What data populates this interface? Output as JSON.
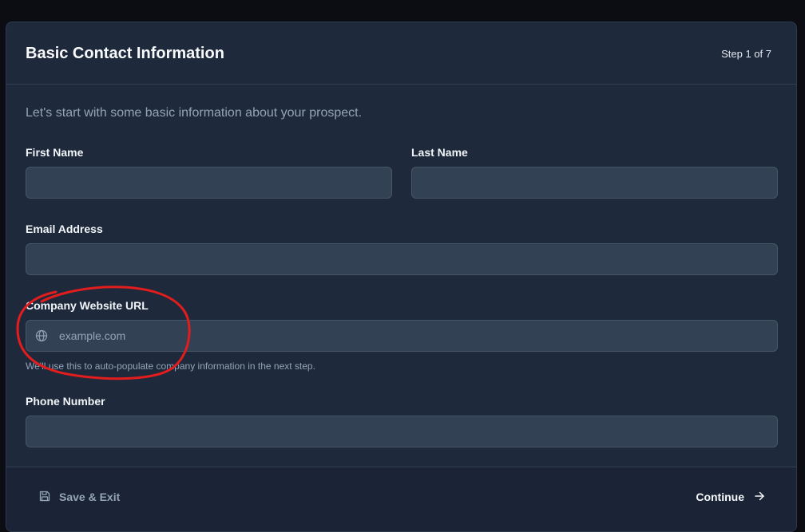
{
  "header": {
    "title": "Basic Contact Information",
    "step": "Step 1 of 7"
  },
  "intro": "Let's start with some basic information about your prospect.",
  "fields": {
    "first_name": {
      "label": "First Name",
      "value": ""
    },
    "last_name": {
      "label": "Last Name",
      "value": ""
    },
    "email": {
      "label": "Email Address",
      "value": ""
    },
    "website": {
      "label": "Company Website URL",
      "placeholder": "example.com",
      "value": "",
      "icon": "globe-icon",
      "help": "We'll use this to auto-populate company information in the next step."
    },
    "phone": {
      "label": "Phone Number",
      "value": ""
    }
  },
  "footer": {
    "save_label": "Save & Exit",
    "save_icon": "floppy-disk-icon",
    "continue_label": "Continue",
    "continue_icon": "arrow-right-icon"
  },
  "colors": {
    "background": "#0b0d12",
    "card": "#1e293b",
    "input": "#334155",
    "annotation": "#e11d1d"
  }
}
